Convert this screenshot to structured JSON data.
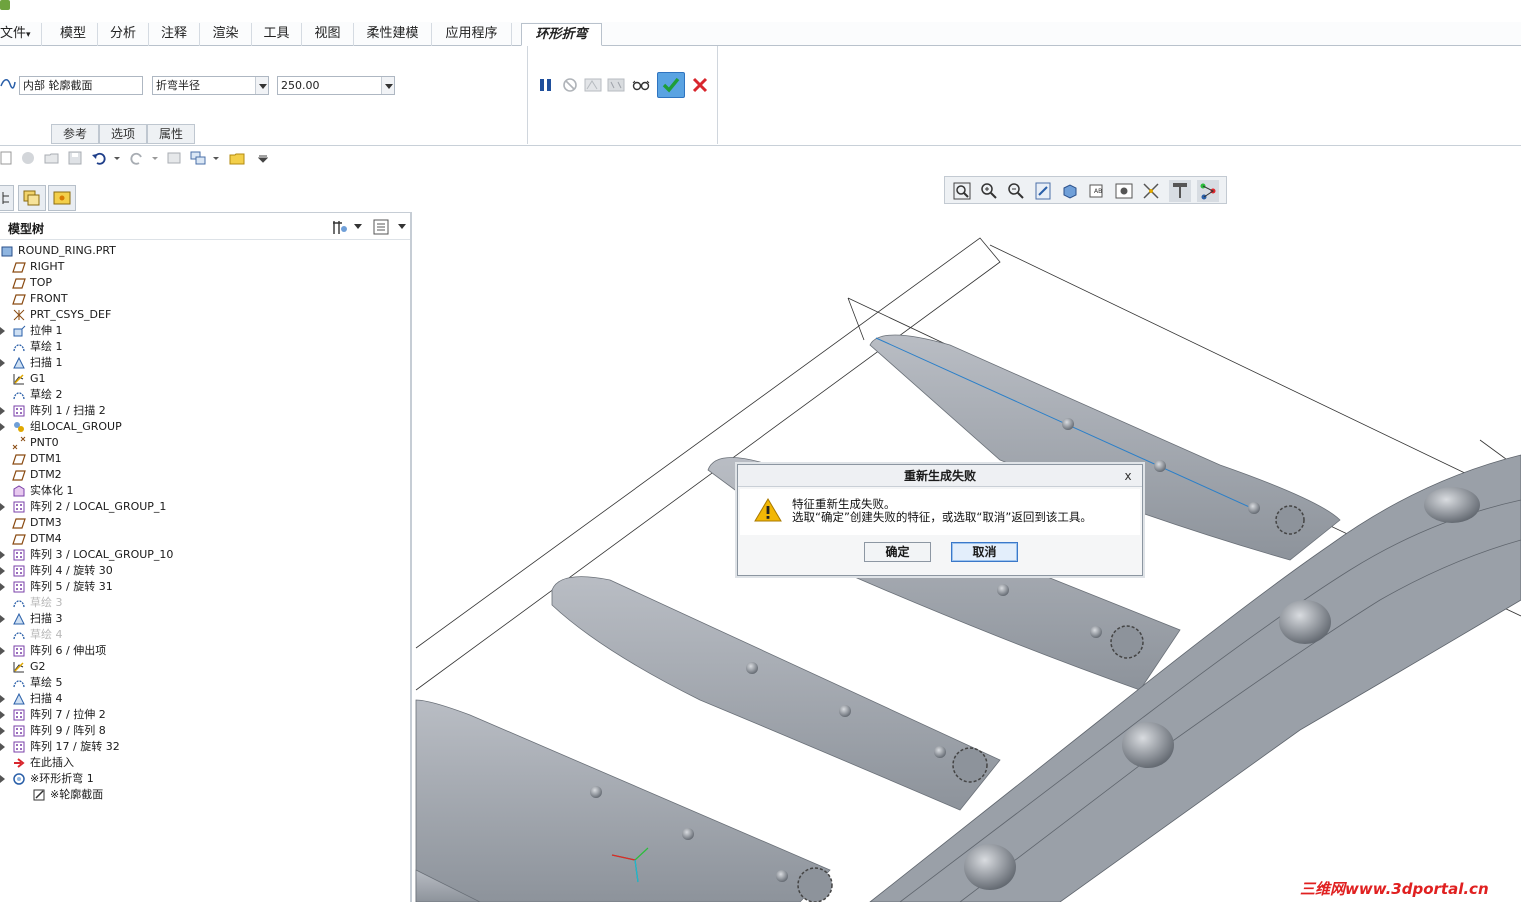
{
  "ribbon": {
    "tabs": [
      {
        "label": "文件"
      },
      {
        "label": "模型"
      },
      {
        "label": "分析"
      },
      {
        "label": "注释"
      },
      {
        "label": "渲染"
      },
      {
        "label": "工具"
      },
      {
        "label": "视图"
      },
      {
        "label": "柔性建模"
      },
      {
        "label": "应用程序"
      },
      {
        "label": "环形折弯"
      }
    ],
    "file_arrow": "▾"
  },
  "dashboard": {
    "profile_field": "内部 轮廓截面",
    "bend_type": "折弯半径",
    "radius_value": "250.00",
    "subtabs": [
      "参考",
      "选项",
      "属性"
    ]
  },
  "model_tree": {
    "title": "模型树",
    "items": [
      {
        "label": "ROUND_RING.PRT",
        "icon": "part-icon",
        "expandable": false,
        "indent": 0,
        "dim": false
      },
      {
        "label": "RIGHT",
        "icon": "datum-plane-icon",
        "expandable": false,
        "indent": 1,
        "dim": false
      },
      {
        "label": "TOP",
        "icon": "datum-plane-icon",
        "expandable": false,
        "indent": 1,
        "dim": false
      },
      {
        "label": "FRONT",
        "icon": "datum-plane-icon",
        "expandable": false,
        "indent": 1,
        "dim": false
      },
      {
        "label": "PRT_CSYS_DEF",
        "icon": "csys-icon",
        "expandable": false,
        "indent": 1,
        "dim": false
      },
      {
        "label": "拉伸 1",
        "icon": "extrude-icon",
        "expandable": true,
        "indent": 1,
        "dim": false
      },
      {
        "label": "草绘 1",
        "icon": "sketch-icon",
        "expandable": false,
        "indent": 1,
        "dim": false
      },
      {
        "label": "扫描 1",
        "icon": "sweep-icon",
        "expandable": true,
        "indent": 1,
        "dim": false
      },
      {
        "label": "G1",
        "icon": "graph-icon",
        "expandable": false,
        "indent": 1,
        "dim": false
      },
      {
        "label": "草绘 2",
        "icon": "sketch-icon",
        "expandable": false,
        "indent": 1,
        "dim": false
      },
      {
        "label": "阵列 1 / 扫描 2",
        "icon": "pattern-icon",
        "expandable": true,
        "indent": 1,
        "dim": false
      },
      {
        "label": "组LOCAL_GROUP",
        "icon": "group-icon",
        "expandable": true,
        "indent": 1,
        "dim": false
      },
      {
        "label": "PNT0",
        "icon": "point-icon",
        "expandable": false,
        "indent": 1,
        "dim": false
      },
      {
        "label": "DTM1",
        "icon": "datum-plane-icon",
        "expandable": false,
        "indent": 1,
        "dim": false
      },
      {
        "label": "DTM2",
        "icon": "datum-plane-icon",
        "expandable": false,
        "indent": 1,
        "dim": false
      },
      {
        "label": "实体化 1",
        "icon": "solidify-icon",
        "expandable": false,
        "indent": 1,
        "dim": false
      },
      {
        "label": "阵列 2 / LOCAL_GROUP_1",
        "icon": "pattern-icon",
        "expandable": true,
        "indent": 1,
        "dim": false
      },
      {
        "label": "DTM3",
        "icon": "datum-plane-icon",
        "expandable": false,
        "indent": 1,
        "dim": false
      },
      {
        "label": "DTM4",
        "icon": "datum-plane-icon",
        "expandable": false,
        "indent": 1,
        "dim": false
      },
      {
        "label": "阵列 3 / LOCAL_GROUP_10",
        "icon": "pattern-icon",
        "expandable": true,
        "indent": 1,
        "dim": false
      },
      {
        "label": "阵列 4 / 旋转 30",
        "icon": "pattern-icon",
        "expandable": true,
        "indent": 1,
        "dim": false
      },
      {
        "label": "阵列 5 / 旋转 31",
        "icon": "pattern-icon",
        "expandable": true,
        "indent": 1,
        "dim": false
      },
      {
        "label": "草绘 3",
        "icon": "sketch-icon",
        "expandable": false,
        "indent": 1,
        "dim": true
      },
      {
        "label": "扫描 3",
        "icon": "sweep-icon",
        "expandable": true,
        "indent": 1,
        "dim": false
      },
      {
        "label": "草绘 4",
        "icon": "sketch-icon",
        "expandable": false,
        "indent": 1,
        "dim": true
      },
      {
        "label": "阵列 6 / 伸出项",
        "icon": "pattern-icon",
        "expandable": true,
        "indent": 1,
        "dim": false
      },
      {
        "label": "G2",
        "icon": "graph-icon",
        "expandable": false,
        "indent": 1,
        "dim": false
      },
      {
        "label": "草绘 5",
        "icon": "sketch-icon",
        "expandable": false,
        "indent": 1,
        "dim": false
      },
      {
        "label": "扫描 4",
        "icon": "sweep-icon",
        "expandable": true,
        "indent": 1,
        "dim": false
      },
      {
        "label": "阵列 7 / 拉伸 2",
        "icon": "pattern-icon",
        "expandable": true,
        "indent": 1,
        "dim": false
      },
      {
        "label": "阵列 9 / 阵列 8",
        "icon": "pattern-icon",
        "expandable": true,
        "indent": 1,
        "dim": false
      },
      {
        "label": "阵列 17 / 旋转 32",
        "icon": "pattern-icon",
        "expandable": true,
        "indent": 1,
        "dim": false
      },
      {
        "label": "在此插入",
        "icon": "insert-here-icon",
        "expandable": false,
        "indent": 1,
        "dim": false
      },
      {
        "label": "※环形折弯 1",
        "icon": "toroidal-bend-icon",
        "expandable": true,
        "indent": 1,
        "dim": false
      },
      {
        "label": "※轮廓截面",
        "icon": "sketch-edit-icon",
        "expandable": false,
        "indent": 2,
        "dim": false
      }
    ]
  },
  "dialog": {
    "title": "重新生成失败",
    "close": "x",
    "line1": "特征重新生成失败。",
    "line2": "选取“确定”创建失败的特征，或选取“取消”返回到该工具。",
    "ok": "确定",
    "cancel": "取消"
  },
  "watermark": "三维网www.3dportal.cn",
  "colors": {
    "accent": "#3b78c9",
    "ok_green": "#1e9e3a",
    "cancel_red": "#d8262d",
    "model_gray": "#a4a9b1",
    "model_shade": "#7c828b",
    "warning": "#f2b705"
  }
}
